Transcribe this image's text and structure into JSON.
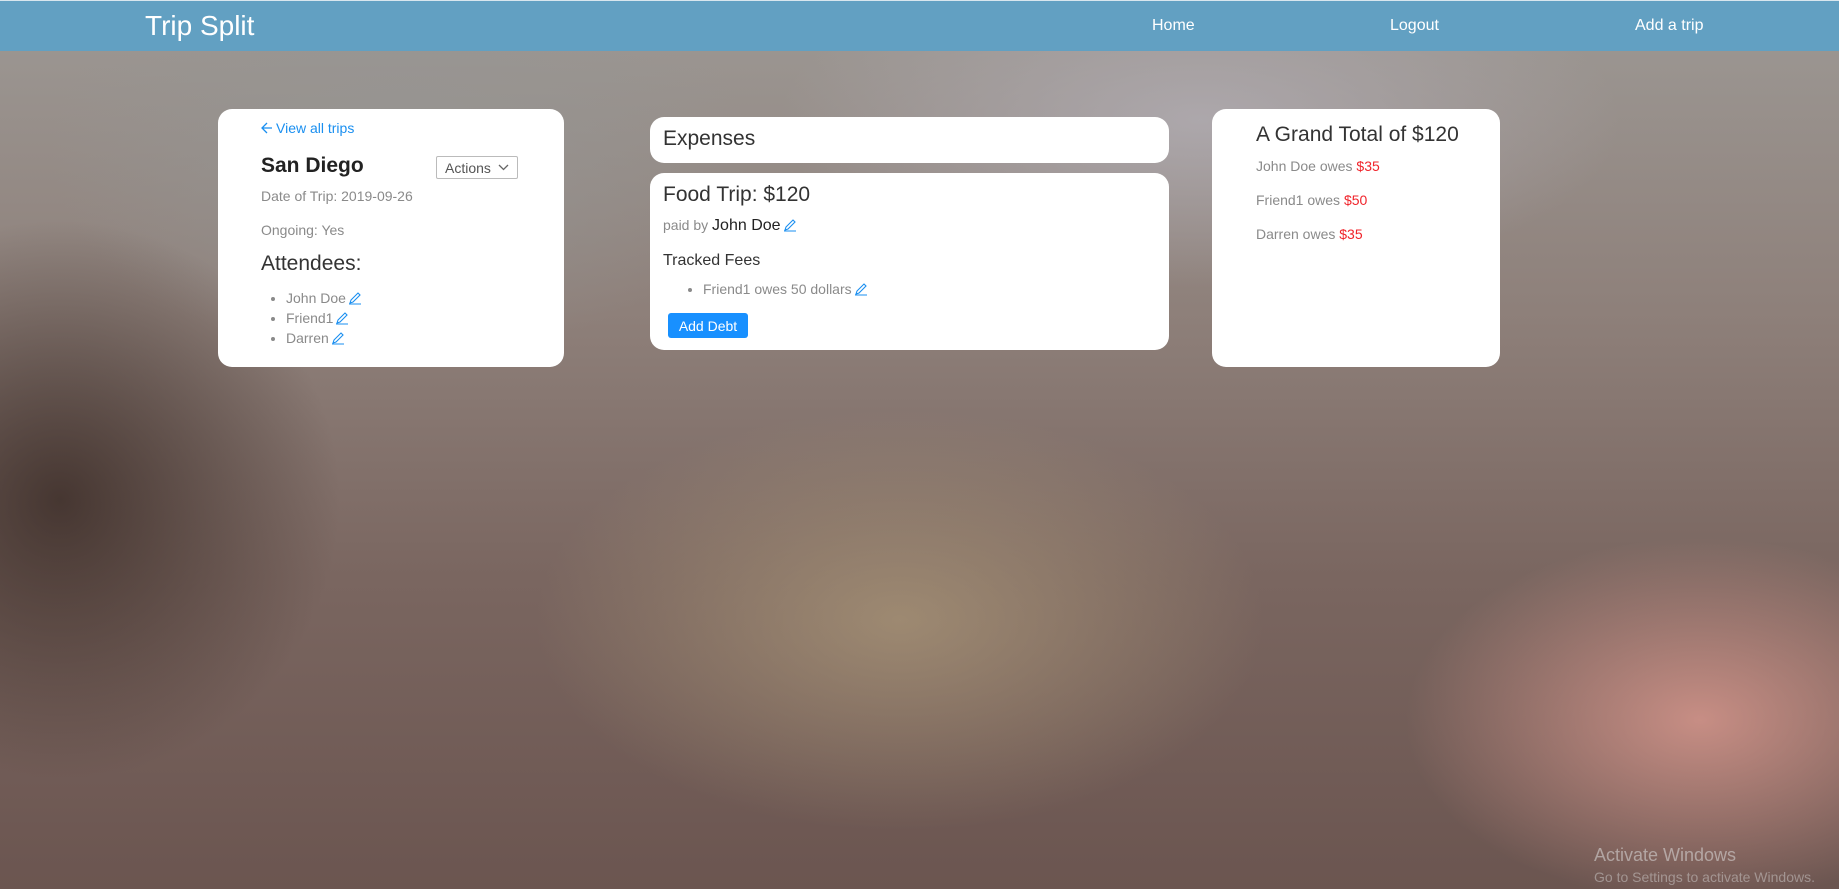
{
  "navbar": {
    "brand": "Trip Split",
    "links": [
      "Home",
      "Logout",
      "Add a trip"
    ]
  },
  "trip": {
    "back_link": "View all trips",
    "name": "San Diego",
    "actions_label": "Actions",
    "date": "Date of Trip: 2019-09-26",
    "ongoing": "Ongoing: Yes",
    "attendees_title": "Attendees:",
    "attendees": [
      "John Doe",
      "Friend1",
      "Darren"
    ]
  },
  "expenses": {
    "title": "Expenses",
    "items": [
      {
        "title": "Food Trip: $120",
        "paid_by_prefix": "paid by",
        "payer": "John Doe",
        "tracked_title": "Tracked Fees",
        "fees": [
          "Friend1 owes 50 dollars"
        ],
        "add_debt_label": "Add Debt"
      }
    ]
  },
  "totals": {
    "title": "A Grand Total of $120",
    "owes": [
      {
        "label": "John Doe owes",
        "amount": "$35"
      },
      {
        "label": "Friend1 owes",
        "amount": "$50"
      },
      {
        "label": "Darren owes",
        "amount": "$35"
      }
    ]
  },
  "watermark": {
    "line1": "Activate Windows",
    "line2": "Go to Settings to activate Windows."
  },
  "colors": {
    "navbar": "#62a0c2",
    "link": "#1a8ff0",
    "button": "#1890ff",
    "amount": "#f0242b"
  }
}
